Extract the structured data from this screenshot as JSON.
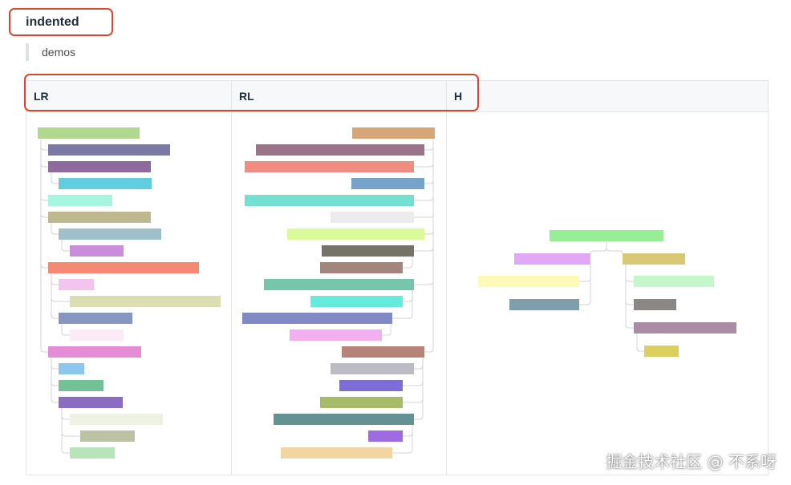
{
  "section": {
    "title": "indented",
    "description": "demos"
  },
  "table": {
    "headers": [
      "LR",
      "RL",
      "H"
    ]
  },
  "colors": {
    "lr": [
      "#b1d88f",
      "#7b7aa6",
      "#8e6a9e",
      "#62cde0",
      "#a5f5e0",
      "#bfb78d",
      "#9fbfcb",
      "#ca8ddc",
      "#f48a74",
      "#f2c4ee",
      "#dcdeb2",
      "#8795c3",
      "#fcebf6",
      "#e68bd6",
      "#8dc7f1",
      "#73c196",
      "#8a6cc1",
      "#edf2e3",
      "#bcc2a3",
      "#b7e4b9"
    ],
    "rl": [
      "#d6a679",
      "#9a7589",
      "#f08d80",
      "#76a3c9",
      "#74dfd2",
      "#ececec",
      "#dbfb9a",
      "#757267",
      "#a3857d",
      "#77c5ab",
      "#64ebdb",
      "#8189c6",
      "#f3b0f0",
      "#b5837a",
      "#bcbcc6",
      "#7c6ed4",
      "#a7bc6b",
      "#649191",
      "#9f6ae6",
      "#f3d5a2"
    ],
    "h": {
      "root": "#97ee96",
      "left_children": [
        "#e2a7f6",
        "#fdf9b8",
        "#7f9eab"
      ],
      "right_children": [
        "#d9c875",
        "#c6f6cb",
        "#8b8784",
        "#aa8da5",
        "#dccf5e"
      ]
    }
  },
  "watermark": "掘金技术社区 @ 不系呀"
}
